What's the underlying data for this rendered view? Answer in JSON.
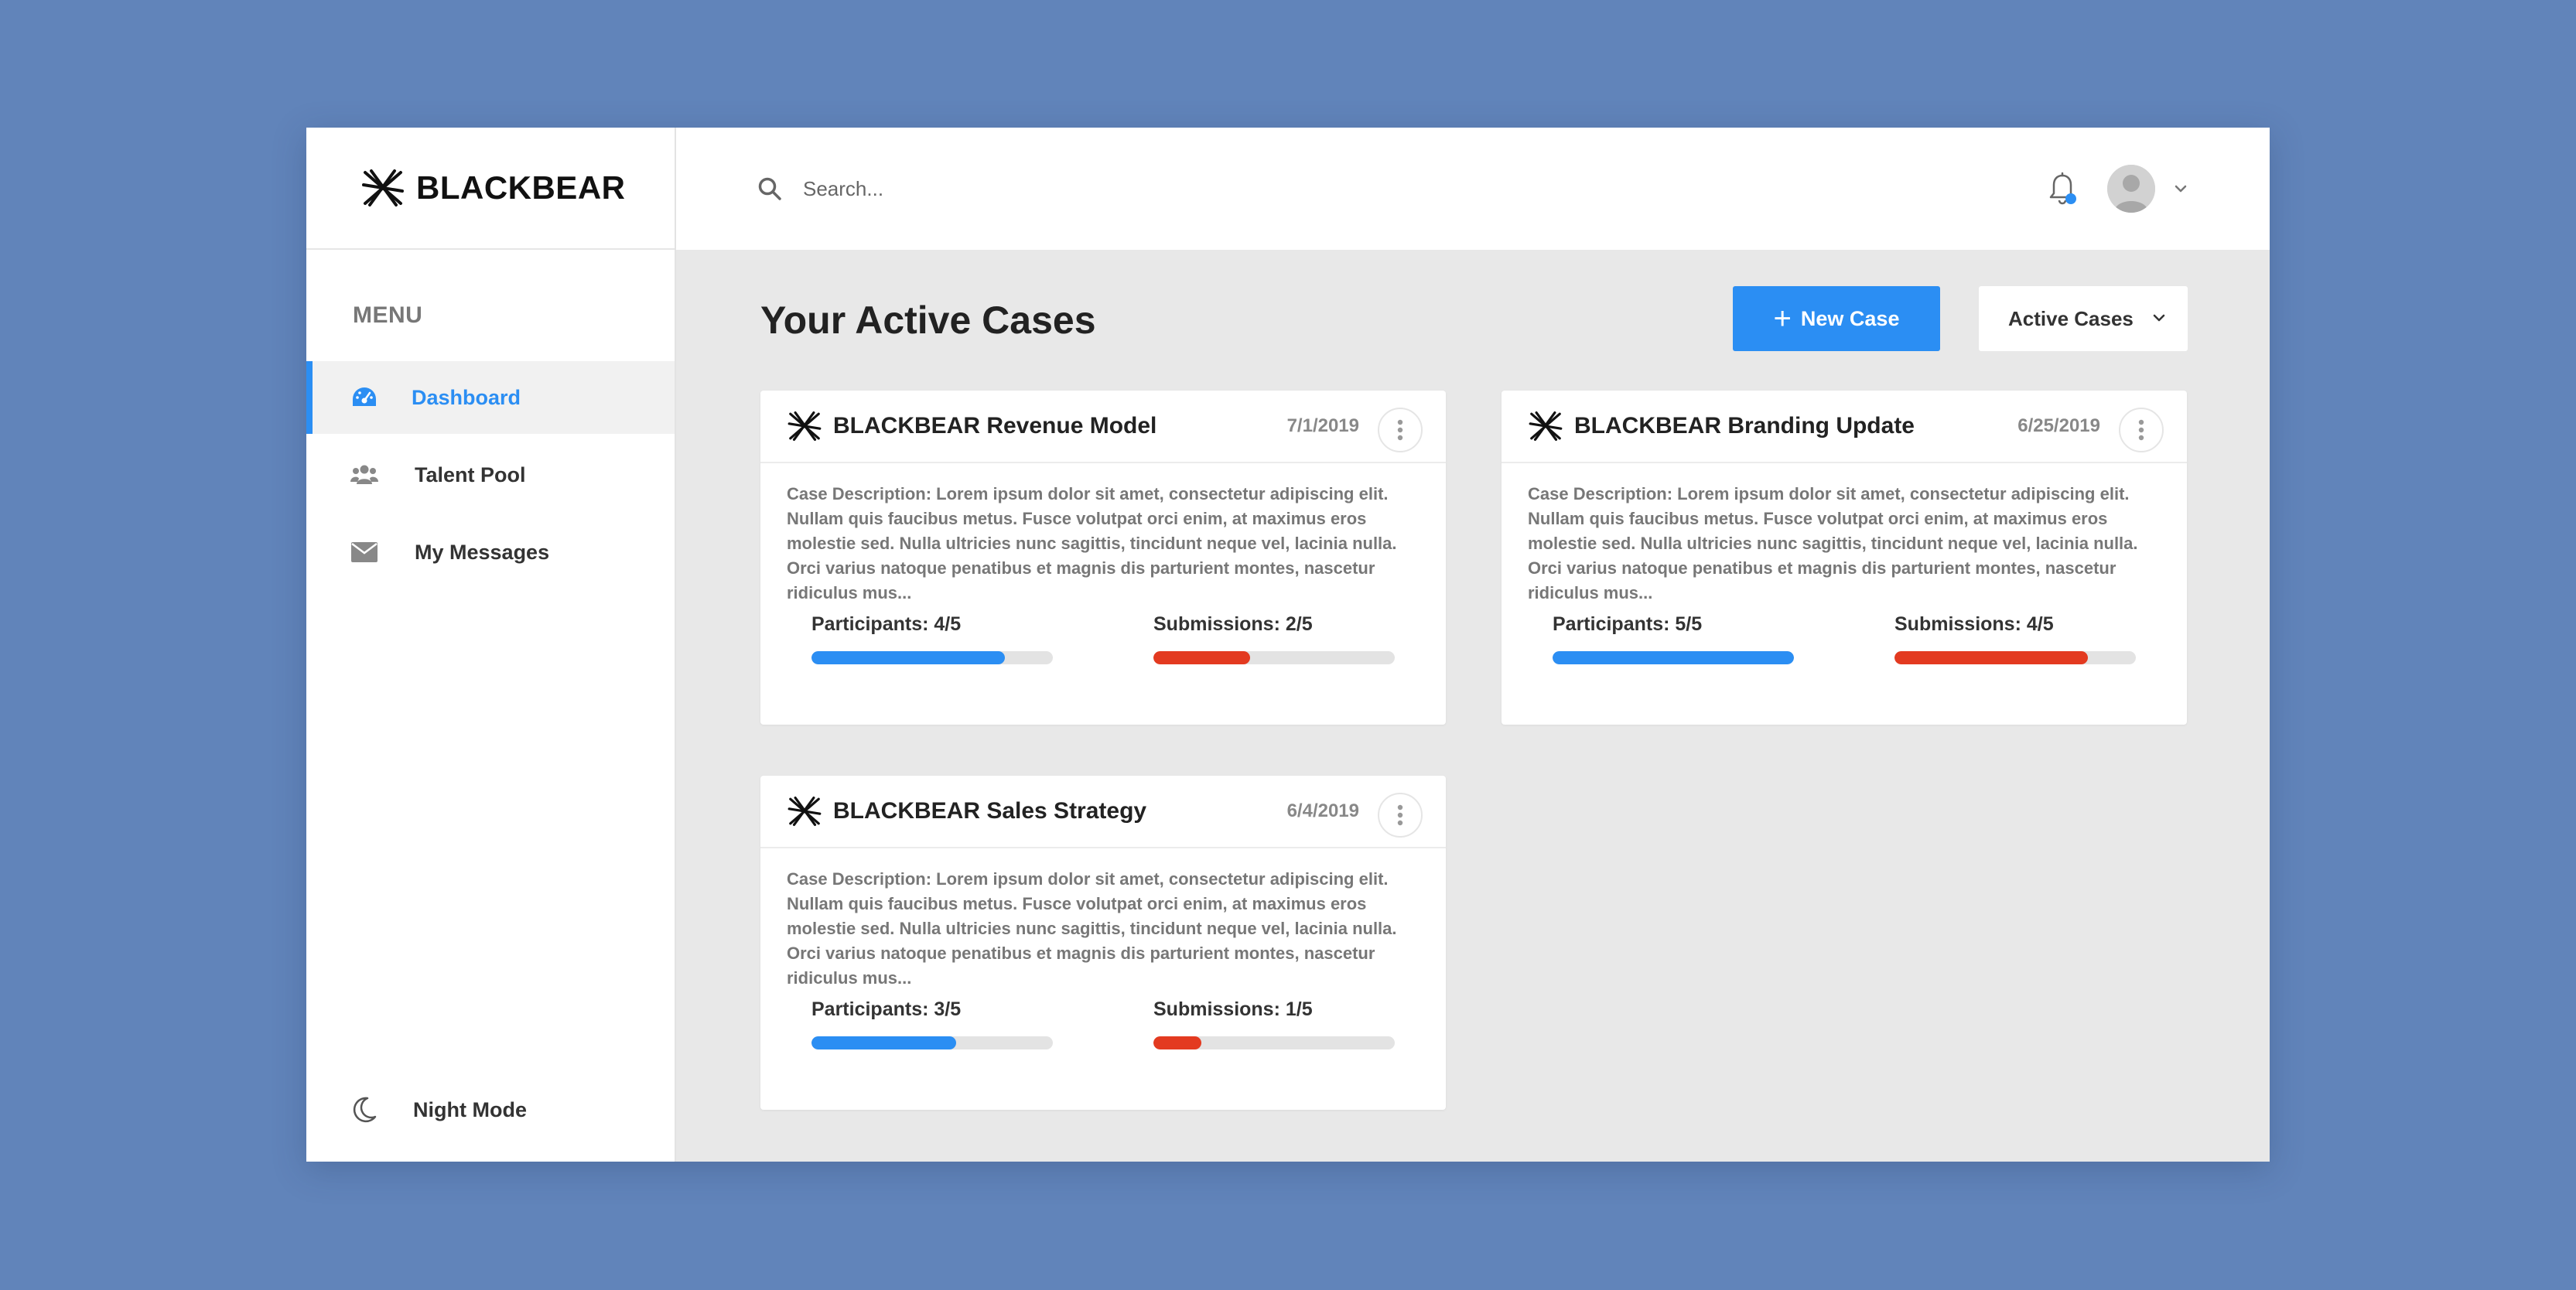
{
  "brand": {
    "name": "BLACKBEAR"
  },
  "sidebar": {
    "menu_title": "MENU",
    "items": [
      {
        "label": "Dashboard",
        "icon": "dashboard-icon",
        "active": true
      },
      {
        "label": "Talent Pool",
        "icon": "users-icon",
        "active": false
      },
      {
        "label": "My Messages",
        "icon": "envelope-icon",
        "active": false
      }
    ],
    "night_mode_label": "Night Mode"
  },
  "header": {
    "search_placeholder": "Search...",
    "notifications_unread": true
  },
  "main": {
    "title": "Your Active Cases",
    "new_case_label": "New Case",
    "filter": {
      "selected": "Active Cases"
    }
  },
  "cases": [
    {
      "title": "BLACKBEAR Revenue Model",
      "date": "7/1/2019",
      "description": "Case Description: Lorem ipsum dolor sit amet, consectetur adipiscing elit. Nullam quis faucibus metus. Fusce volutpat orci enim, at maximus eros molestie sed. Nulla ultricies nunc sagittis, tincidunt neque vel, lacinia nulla. Orci varius natoque penatibus et magnis dis parturient montes, nascetur ridiculus mus...",
      "participants_label": "Participants: 4/5",
      "participants_progress": 0.8,
      "submissions_label": "Submissions: 2/5",
      "submissions_progress": 0.4
    },
    {
      "title": "BLACKBEAR Branding Update",
      "date": "6/25/2019",
      "description": "Case Description: Lorem ipsum dolor sit amet, consectetur adipiscing elit. Nullam quis faucibus metus. Fusce volutpat orci enim, at maximus eros molestie sed. Nulla ultricies nunc sagittis, tincidunt neque vel, lacinia nulla. Orci varius natoque penatibus et magnis dis parturient montes, nascetur ridiculus mus...",
      "participants_label": "Participants: 5/5",
      "participants_progress": 1.0,
      "submissions_label": "Submissions: 4/5",
      "submissions_progress": 0.8
    },
    {
      "title": "BLACKBEAR Sales Strategy",
      "date": "6/4/2019",
      "description": "Case Description: Lorem ipsum dolor sit amet, consectetur adipiscing elit. Nullam quis faucibus metus. Fusce volutpat orci enim, at maximus eros molestie sed. Nulla ultricies nunc sagittis, tincidunt neque vel, lacinia nulla. Orci varius natoque penatibus et magnis dis parturient montes, nascetur ridiculus mus...",
      "participants_label": "Participants: 3/5",
      "participants_progress": 0.6,
      "submissions_label": "Submissions: 1/5",
      "submissions_progress": 0.2
    }
  ],
  "colors": {
    "background": "#6184ba",
    "accent": "#2b8ef3",
    "participants_bar": "#2b8ef3",
    "submissions_bar": "#e33a20"
  }
}
